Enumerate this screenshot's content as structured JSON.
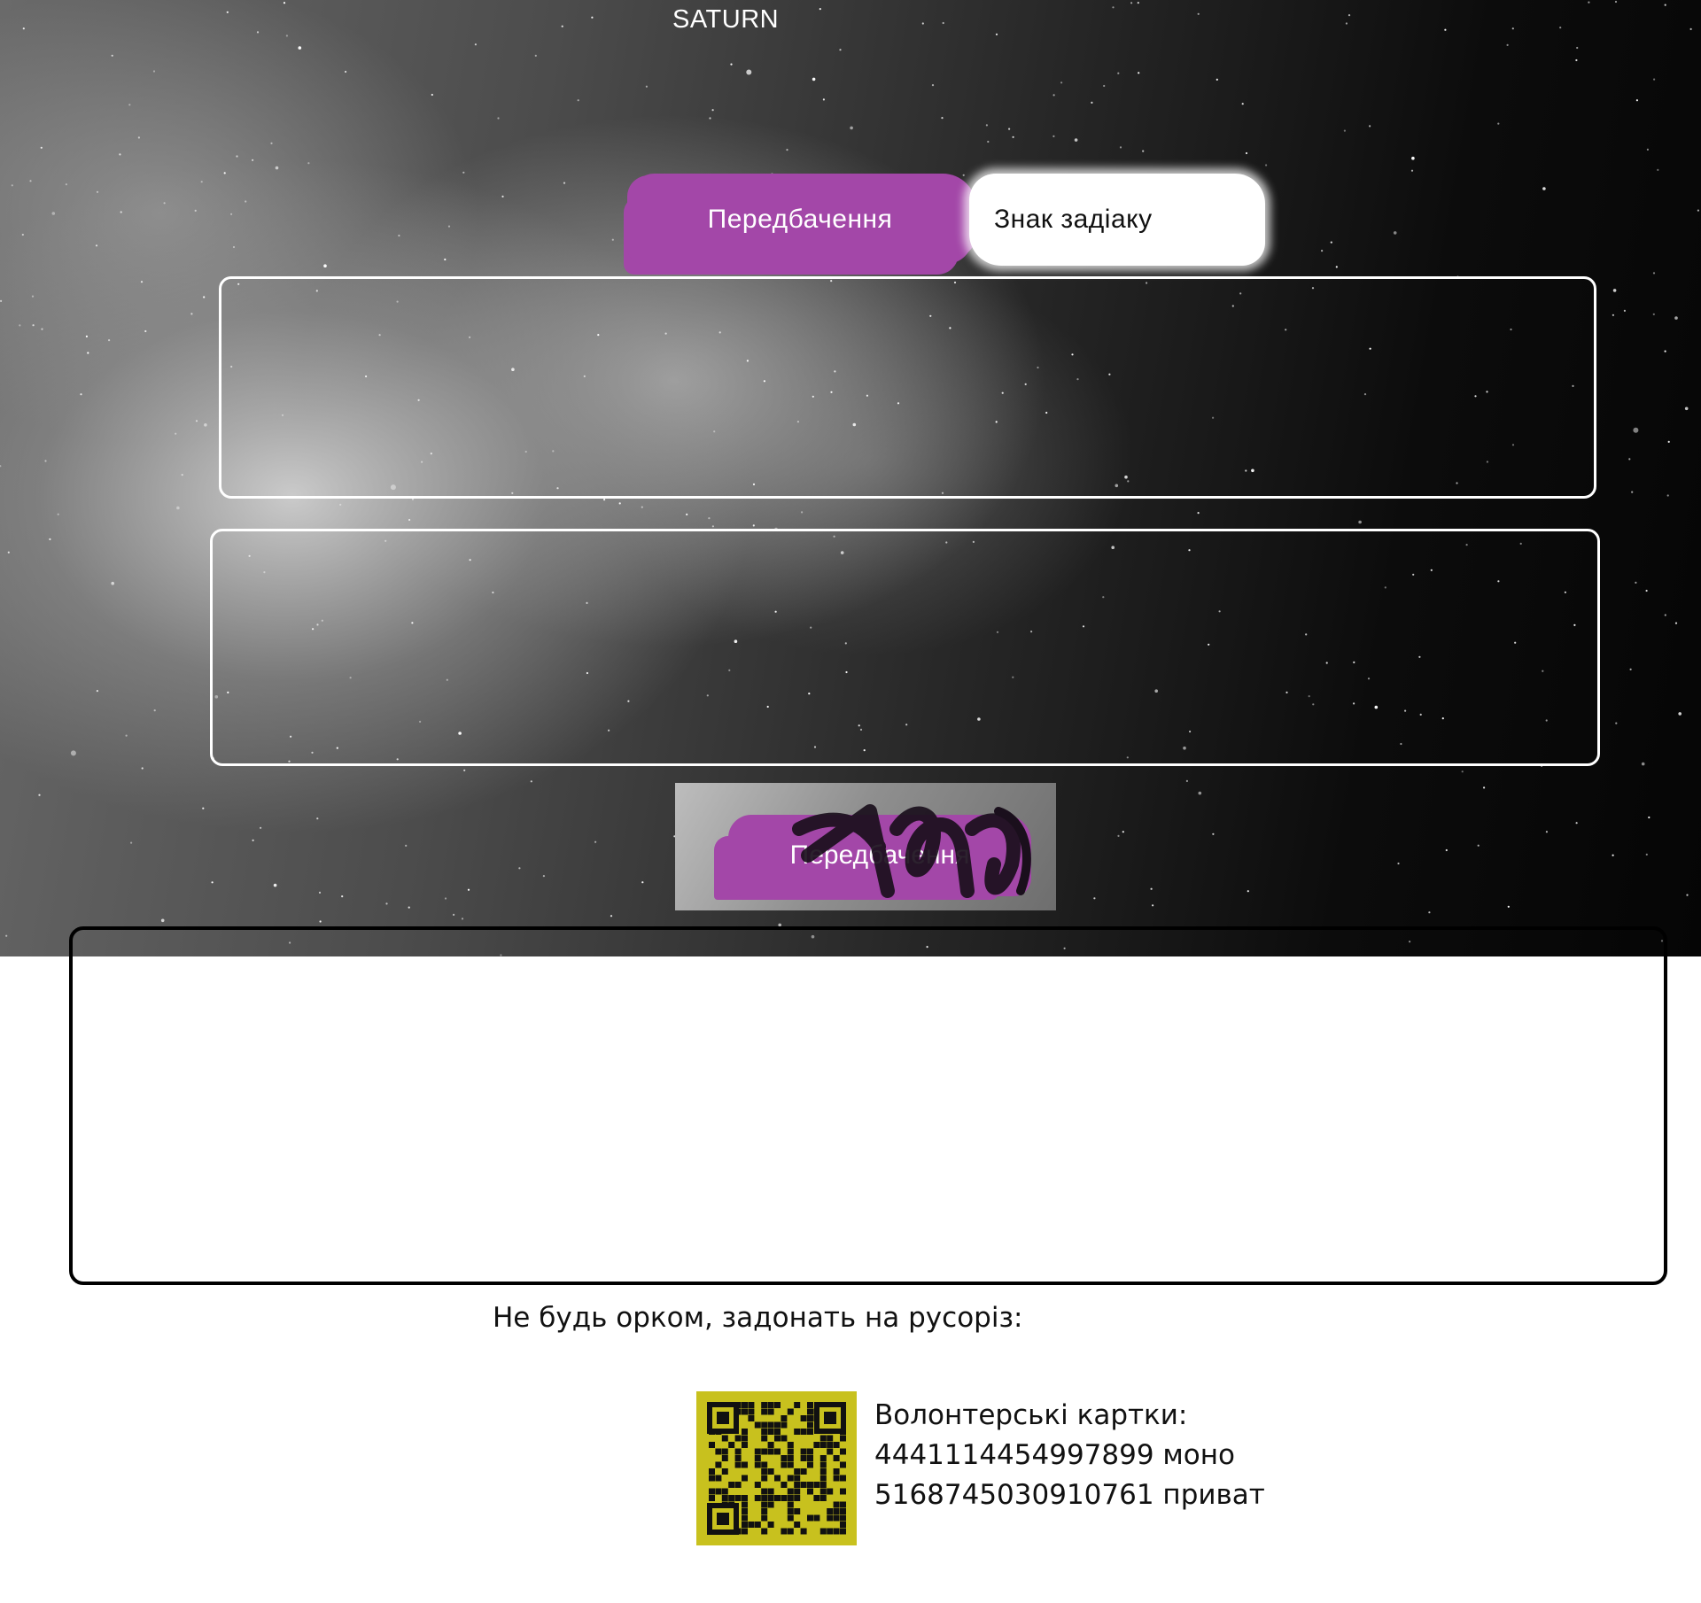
{
  "brand": {
    "title": "SATURN"
  },
  "tabs": [
    {
      "label": "Передбачення",
      "active": true
    },
    {
      "label": "Знак задіаку",
      "active": false
    }
  ],
  "inputs": {
    "first_value": "",
    "second_value": ""
  },
  "submit": {
    "label": "Передбачення"
  },
  "result": {
    "text": ""
  },
  "donation": {
    "headline": "Не будь орком, задонать на русоріз:",
    "cards_title": "Волонтерські картки:",
    "card_mono": "4441114454997899 моно",
    "card_privat": "5168745030910761 приват"
  },
  "colors": {
    "accent": "#a347a8",
    "qr_background": "#c8c11e"
  },
  "icons": {
    "qr": "qr-code-icon"
  }
}
